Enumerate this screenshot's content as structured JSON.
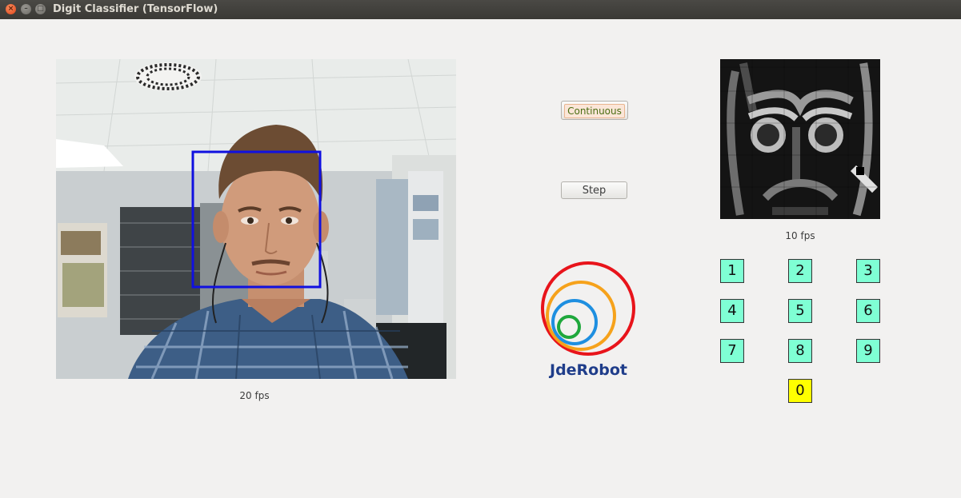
{
  "window": {
    "title": "Digit Classifier (TensorFlow)",
    "close_glyph": "×",
    "minimize_glyph": "–",
    "maximize_glyph": "□"
  },
  "camera": {
    "fps_label": "20 fps"
  },
  "controls": {
    "continuous_label": "Continuous",
    "step_label": "Step"
  },
  "logo": {
    "text": "JdeRobot",
    "ring_colors": [
      "#e8141b",
      "#f6a21b",
      "#1e8fe0",
      "#1fa83c"
    ]
  },
  "digit_view": {
    "fps_label": "10 fps"
  },
  "keypad": {
    "keys": [
      "1",
      "2",
      "3",
      "4",
      "5",
      "6",
      "7",
      "8",
      "9",
      "0"
    ],
    "predicted": "0",
    "colors": {
      "idle": "#7fffd4",
      "active": "#ffff00"
    }
  }
}
